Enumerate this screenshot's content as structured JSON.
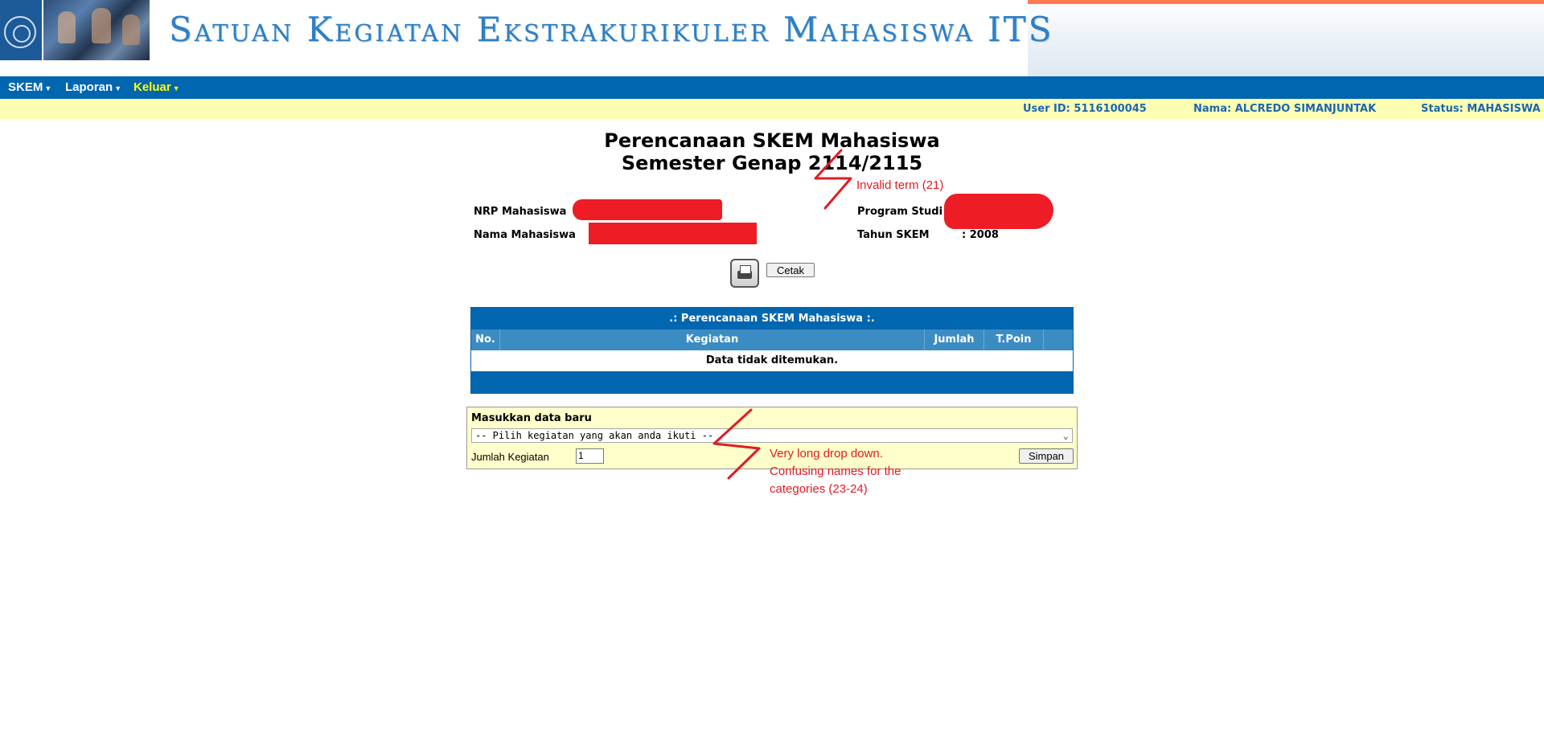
{
  "header": {
    "banner_title": "Satuan Kegiatan Ekstrakurikuler Mahasiswa ITS"
  },
  "nav": {
    "items": [
      {
        "label": "SKEM",
        "color": "#ffffff"
      },
      {
        "label": "Laporan",
        "color": "#ffffff"
      },
      {
        "label": "Keluar",
        "color": "#ffff00"
      }
    ]
  },
  "userbar": {
    "user_id": "User ID: 5116100045",
    "nama": "Nama: ALCREDO SIMANJUNTAK",
    "status": "Status: MAHASISWA"
  },
  "page": {
    "title": "Perencanaan SKEM Mahasiswa",
    "semester": "Semester Genap 2114/2115"
  },
  "info": {
    "nrp_label": "NRP Mahasiswa",
    "nama_label": "Nama Mahasiswa",
    "prodi_label": "Program Studi",
    "tahun_label": "Tahun SKEM",
    "tahun_value": ":  2008"
  },
  "print": {
    "cetak_label": "Cetak"
  },
  "table": {
    "caption": ".: Perencanaan SKEM Mahasiswa :.",
    "headers": [
      "No.",
      "Kegiatan",
      "Jumlah",
      "T.Poin",
      ""
    ],
    "empty_message": "Data tidak ditemukan."
  },
  "form": {
    "title": "Masukkan data baru",
    "select_value": "-- Pilih kegiatan yang akan anda ikuti --",
    "qty_label": "Jumlah Kegiatan",
    "qty_value": "1",
    "save_label": "Simpan"
  },
  "annotations": {
    "invalid_term": "Invalid term  (21)",
    "dropdown_note_1": "Very long drop down.",
    "dropdown_note_2": "Confusing names for the",
    "dropdown_note_3": "categories  (23-24)",
    "color": "#e01c24"
  },
  "colors": {
    "nav_bg": "#0066b0",
    "userbar_bg": "#ffffb4",
    "table_bg": "#0066b0",
    "table_head_bg": "#3c8cc4",
    "form_bg": "#ffffcc",
    "redaction": "#ee1c24"
  }
}
